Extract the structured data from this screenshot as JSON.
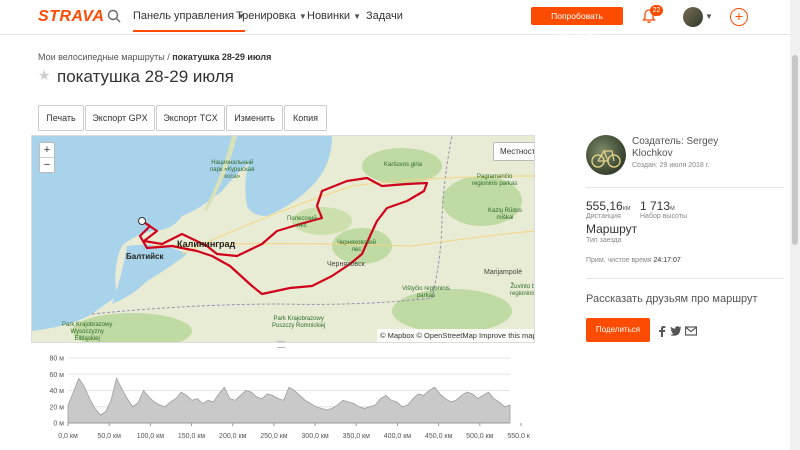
{
  "nav": {
    "logo": "STRAVA",
    "items": [
      {
        "label": "Панель управления",
        "chevron": true,
        "active": true
      },
      {
        "label": "Тренировка",
        "chevron": true,
        "active": false
      },
      {
        "label": "Новинки",
        "chevron": true,
        "active": false
      },
      {
        "label": "Задачи",
        "chevron": false,
        "active": false
      }
    ],
    "try_button": "Попробовать бесплатно",
    "notifications_count": "22"
  },
  "breadcrumb": {
    "parent": "Мои велосипедные маршруты",
    "separator": "/",
    "current": "покатушка 28-29 июля"
  },
  "title": "покатушка 28-29 июля",
  "actions": [
    "Печать",
    "Экспорт GPX",
    "Экспорт TCX",
    "Изменить",
    "Копия"
  ],
  "map": {
    "terrain_button": "Местность",
    "zoom_in": "+",
    "zoom_out": "−",
    "attribution": "© Mapbox © OpenStreetMap Improve this map",
    "labels": {
      "national_park": "Национальный\nпарк «Куршская\nкоса»",
      "karsuvos": "Karšuvos giria",
      "pagramancio": "Pagramančio\nregioninis parkas",
      "kazlu": "Kazlų Rūdos\nmiškai",
      "polesskiy": "Полесский\nлес",
      "kaliningrad": "Калининград",
      "baltiysk": "Балтийск",
      "chernyakhovskiy": "Черняховский\nлес",
      "chernyakhovsk": "Черняховск",
      "marijampole": "Marijampolė",
      "zuvinto": "Žuvinto b\nregioninis",
      "vistytis": "Vištyčio regioninis\nparkas",
      "wyszwyt": "Park Krajobrazowy\nPuszczy Romnickiej",
      "wydmy": "Park Krajobrazowy\nWysoczyzny\nElbląskiej"
    }
  },
  "elevation": {
    "y_ticks": [
      "80 м",
      "60 м",
      "40 м",
      "20 м",
      "0 м"
    ],
    "x_ticks": [
      "0,0 км",
      "50,0 км",
      "100,0 км",
      "150,0 км",
      "200,0 км",
      "250,0 км",
      "300,0 км",
      "350,0 км",
      "400,0 км",
      "450,0 км",
      "500,0 км",
      "550,0 км"
    ],
    "profile_m": [
      22,
      38,
      55,
      45,
      30,
      18,
      10,
      14,
      28,
      55,
      42,
      30,
      20,
      25,
      40,
      32,
      26,
      22,
      20,
      26,
      30,
      38,
      34,
      28,
      30,
      24,
      28,
      26,
      36,
      44,
      30,
      28,
      34,
      40,
      38,
      32,
      30,
      36,
      34,
      30,
      28,
      44,
      40,
      34,
      28,
      24,
      20,
      18,
      16,
      18,
      22,
      28,
      26,
      24,
      20,
      18,
      20,
      22,
      30,
      34,
      28,
      26,
      20,
      22,
      30,
      36,
      34,
      40,
      44,
      36,
      30,
      26,
      28,
      34,
      38,
      36,
      30,
      34,
      38,
      30,
      26,
      20,
      22
    ]
  },
  "sidebar": {
    "creator": "Создатель: Sergey Klochkov",
    "created": "Создан: 29 июля 2018 г.",
    "distance_value": "555,16",
    "distance_unit": "км",
    "distance_label": "Дистанция",
    "elevation_value": "1 713",
    "elevation_unit": "м",
    "elevation_label": "Набор высоты",
    "route_type": "Маршрут",
    "route_type_label": "Тип заезда",
    "moving_time_label": "Прим. чистое время",
    "moving_time": "24:17:07",
    "share_title": "Рассказать друзьям про маршрут",
    "share_button": "Поделиться"
  },
  "colors": {
    "brand": "#fc4c02",
    "route": "#d0021b",
    "land": "#e9ecd4",
    "water": "#a9d3ea",
    "forest": "#bfdaa2"
  }
}
